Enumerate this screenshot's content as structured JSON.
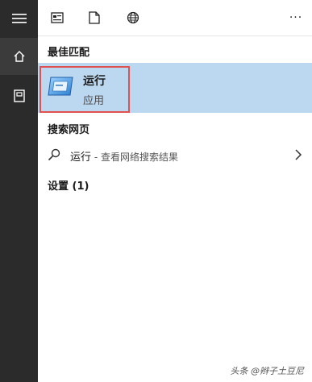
{
  "sections": {
    "best_match": "最佳匹配",
    "search_web": "搜索网页",
    "settings": "设置 (1)"
  },
  "best_match_item": {
    "name": "运行",
    "type": "应用"
  },
  "web_result": {
    "query": "运行",
    "hint": " - 查看网络搜索结果"
  },
  "topbar": {
    "more": "···"
  },
  "watermark": "头条 @辫子土豆尼",
  "colors": {
    "rail_bg": "#2b2b2b",
    "selected_bg": "#bcd7f0",
    "highlight_border": "#e05252"
  },
  "icons": [
    "menu-icon",
    "home-icon",
    "notebook-icon",
    "document-icon",
    "file-icon",
    "globe-icon",
    "more-icon",
    "run-app-icon",
    "search-icon",
    "chevron-right-icon"
  ]
}
